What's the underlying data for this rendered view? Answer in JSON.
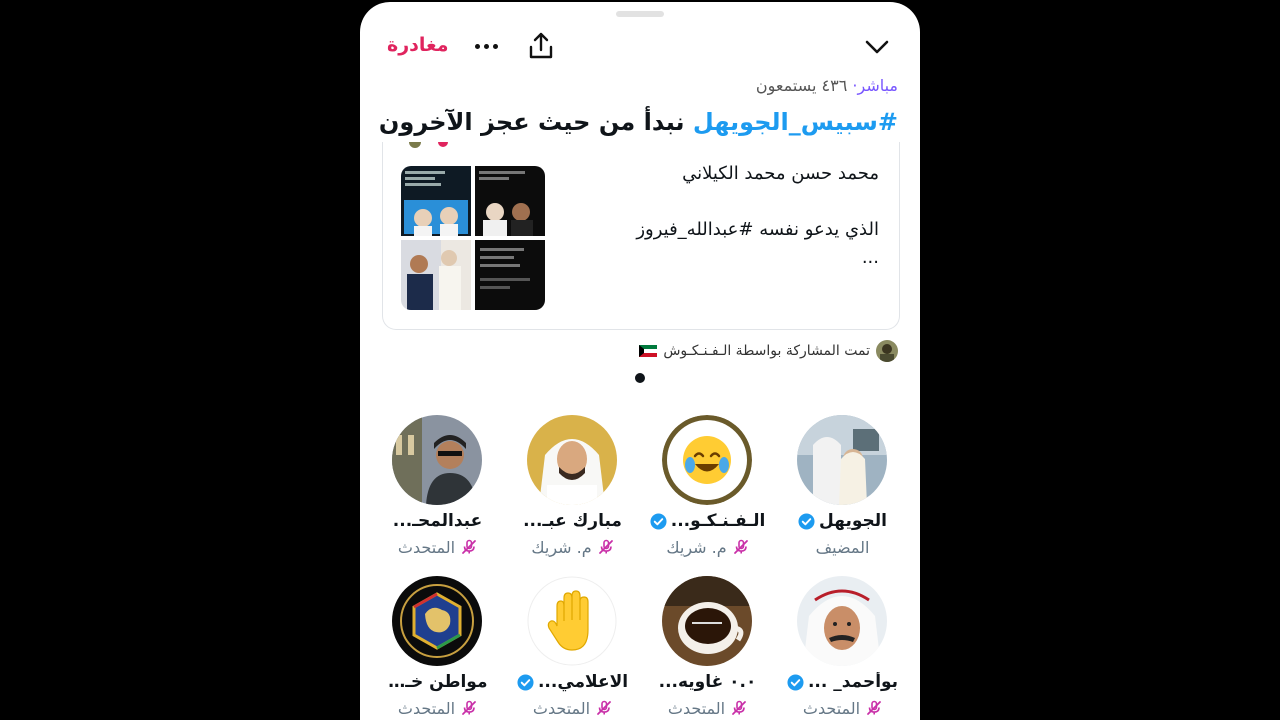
{
  "header": {
    "leave_label": "مغادرة",
    "more_icon": "more-horizontal-icon",
    "share_icon": "share-icon",
    "collapse_icon": "chevron-down-icon"
  },
  "space": {
    "live_label": "مباشر·",
    "listeners": "٤٣٦ يستمعون",
    "title_hashtag": "#سبيس_الجويهل",
    "title_rest": " نبدأ من حيث عجز الآخرون"
  },
  "pinned_tweet": {
    "line1": "محمد حسن محمد الكيلاني",
    "line2": "الذي يدعو نفسه #عبدالله_فيروز",
    "line3": "..."
  },
  "shared_by": {
    "text": "تمت المشاركة بواسطة الـفـنـكـوش",
    "flag_icon": "kuwait-flag-icon"
  },
  "speakers": [
    {
      "name": "الجويهل",
      "role": "المضيف",
      "verified": true,
      "muted": false
    },
    {
      "name": "الـفـنـكـو...",
      "role": "م. شريك",
      "verified": true,
      "muted": true
    },
    {
      "name": "مبارك عبـ...",
      "role": "م. شريك",
      "verified": false,
      "muted": true
    },
    {
      "name": "عبدالمحـ...",
      "role": "المتحدث",
      "verified": false,
      "muted": true
    },
    {
      "name": "بوأحمد_ ...",
      "role": "المتحدث",
      "verified": true,
      "muted": true
    },
    {
      "name": "٠.٠ غاويه...",
      "role": "المتحدث",
      "verified": false,
      "muted": true
    },
    {
      "name": "الاعلامي...",
      "role": "المتحدث",
      "verified": true,
      "muted": true
    },
    {
      "name": "مواطن خـ...",
      "role": "المتحدث",
      "verified": false,
      "muted": true
    }
  ],
  "colors": {
    "leave": "#e0245e",
    "hashtag": "#1d9bf0",
    "live": "#7856ff",
    "verified": "#1d9bf0",
    "muted_mic": "#c930a8"
  }
}
